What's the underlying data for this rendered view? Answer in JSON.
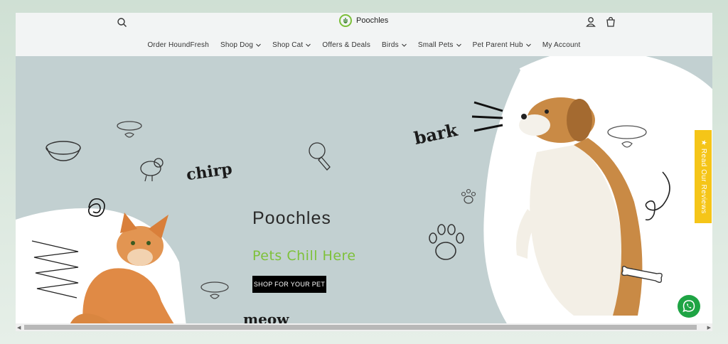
{
  "header": {
    "logo_text": "Poochles",
    "search_icon": "search-icon",
    "account_icon": "account-icon",
    "cart_icon": "cart-icon"
  },
  "nav": {
    "items": [
      {
        "label": "Order HoundFresh",
        "has_dropdown": false
      },
      {
        "label": "Shop Dog",
        "has_dropdown": true
      },
      {
        "label": "Shop Cat",
        "has_dropdown": true
      },
      {
        "label": "Offers & Deals",
        "has_dropdown": false
      },
      {
        "label": "Birds",
        "has_dropdown": true
      },
      {
        "label": "Small Pets",
        "has_dropdown": true
      },
      {
        "label": "Pet Parent Hub",
        "has_dropdown": true
      },
      {
        "label": "My Account",
        "has_dropdown": false
      }
    ]
  },
  "hero": {
    "title": "Poochles",
    "subtitle": "Pets Chill Here",
    "cta_label": "SHOP FOR YOUR PET",
    "doodles": {
      "chirp": "chirp",
      "bark": "bark",
      "meow": "meow"
    },
    "colors": {
      "background": "#c2d0d1",
      "subtitle": "#7ec13a",
      "cta_bg": "#000000"
    }
  },
  "widgets": {
    "reviews_tab": "★ Read Our Reviews",
    "reviews_color": "#f5c518",
    "whatsapp_icon": "whatsapp-icon",
    "whatsapp_color": "#1ea444"
  }
}
